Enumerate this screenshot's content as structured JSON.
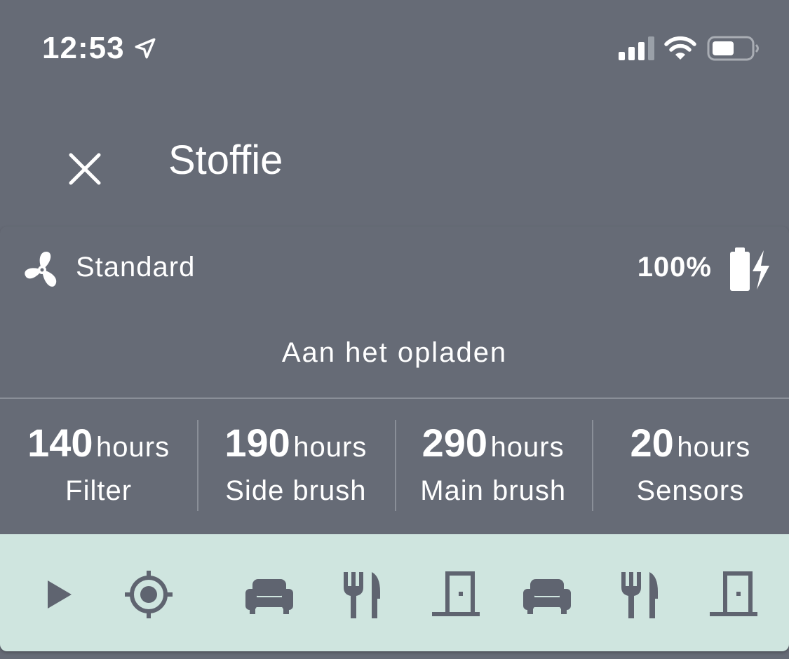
{
  "status_bar": {
    "time": "12:53",
    "icons": [
      "location-arrow-icon",
      "signal-icon",
      "wifi-icon",
      "battery-icon"
    ]
  },
  "header": {
    "close_icon": "close-icon",
    "title": "Stoffie"
  },
  "vacuum": {
    "fan_icon": "fan-icon",
    "fan_mode": "Standard",
    "battery_level": "100%",
    "battery_icon": "battery-charging-icon",
    "state": "Aan het opladen"
  },
  "maintenance": [
    {
      "value": "140",
      "unit": "hours",
      "label": "Filter"
    },
    {
      "value": "190",
      "unit": "hours",
      "label": "Side brush"
    },
    {
      "value": "290",
      "unit": "hours",
      "label": "Main brush"
    },
    {
      "value": "20",
      "unit": "hours",
      "label": "Sensors"
    }
  ],
  "controls": [
    "play-icon",
    "locate-icon",
    "sofa-icon",
    "utensils-icon",
    "door-icon",
    "sofa-icon",
    "utensils-icon",
    "door-icon"
  ],
  "colors": {
    "background": "#666b76",
    "text": "#ffffff",
    "divider": "#8a8f98",
    "controls_background": "#cfe5df",
    "control_icon": "#5f6470"
  }
}
